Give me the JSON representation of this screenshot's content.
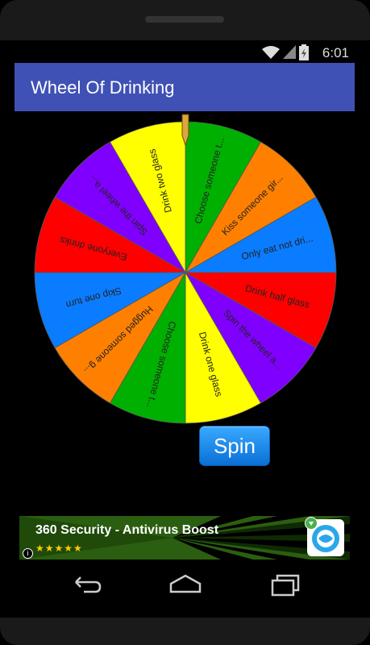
{
  "status_bar": {
    "time": "6:01"
  },
  "app_bar": {
    "title": "Wheel Of Drinking"
  },
  "wheel": {
    "segments": [
      {
        "label": "Choose someone t...",
        "color": "#00b000"
      },
      {
        "label": "Kiss someone gir...",
        "color": "#ff8000"
      },
      {
        "label": "Only eat not dri...",
        "color": "#0a7cff"
      },
      {
        "label": "Drink half glass",
        "color": "#ff0000"
      },
      {
        "label": "Spin the wheel a...",
        "color": "#8000ff"
      },
      {
        "label": "Drink one glass",
        "color": "#ffff00"
      },
      {
        "label": "Choose someone t...",
        "color": "#00b000"
      },
      {
        "label": "Hugged someone g...",
        "color": "#ff8000"
      },
      {
        "label": "Skip one turn",
        "color": "#0a7cff"
      },
      {
        "label": "Everyone drinks",
        "color": "#ff0000"
      },
      {
        "label": "Spin the wheel a...",
        "color": "#8000ff"
      },
      {
        "label": "Drink two glass",
        "color": "#ffff00"
      }
    ]
  },
  "spin_button": {
    "label": "Spin"
  },
  "ad": {
    "title": "360 Security - Antivirus Boost",
    "rating_stars": "★★★★★",
    "info_icon": "i"
  },
  "nav": {
    "back": "back-icon",
    "home": "home-icon",
    "recents": "recents-icon"
  }
}
